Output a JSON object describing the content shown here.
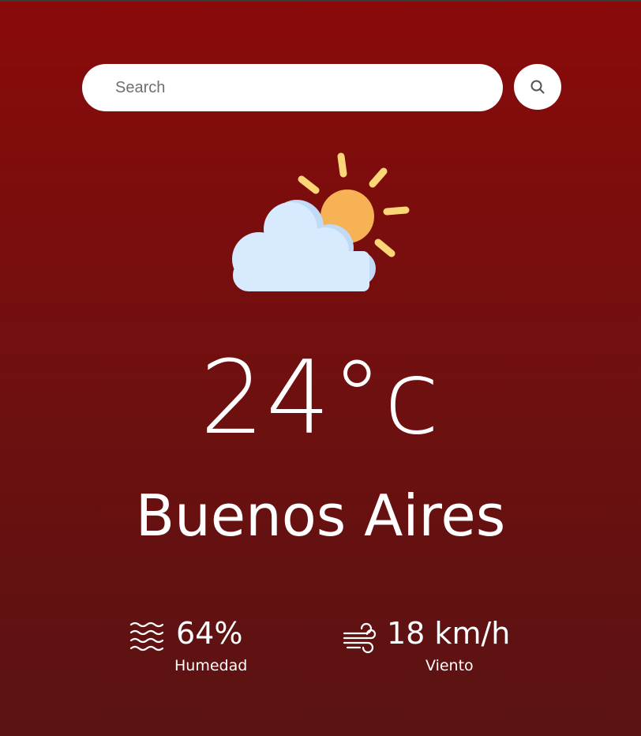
{
  "search": {
    "placeholder": "Search"
  },
  "weather": {
    "icon": "partly-cloudy-icon",
    "temperature": "24°c",
    "city": "Buenos Aires"
  },
  "details": {
    "humidity": {
      "icon": "waves-icon",
      "value": "64%",
      "label": "Humedad"
    },
    "wind": {
      "icon": "wind-icon",
      "value": "18 km/h",
      "label": "Viento"
    }
  },
  "colors": {
    "background_top": "#8a0a0a",
    "background_bottom": "#5a1212",
    "sun": "#f6b255",
    "sun_rays": "#fcd576",
    "cloud": "#d8eafd",
    "cloud_shade": "#c1dbf6"
  }
}
